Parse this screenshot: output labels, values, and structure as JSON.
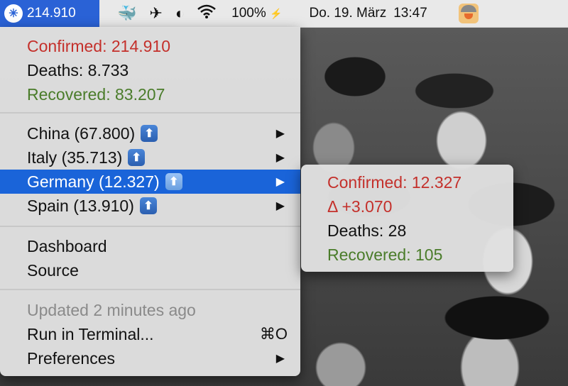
{
  "menubar": {
    "app_count": "214.910",
    "app_icon": "covid-tracker-icon",
    "icons": [
      "docker-icon",
      "paper-plane-icon",
      "half-circle-icon",
      "wifi-icon"
    ],
    "battery": "100%",
    "battery_symbol": "⚡",
    "date": "Do. 19. März",
    "time": "13:47",
    "avatar": "viking-avatar"
  },
  "menu": {
    "summary": {
      "confirmed": "Confirmed: 214.910",
      "deaths": "Deaths: 8.733",
      "recovered": "Recovered: 83.207"
    },
    "countries": [
      {
        "label": "China (67.800)",
        "arrow": "▶"
      },
      {
        "label": "Italy (35.713)",
        "arrow": "▶"
      },
      {
        "label": "Germany (12.327)",
        "arrow": "▶"
      },
      {
        "label": "Spain (13.910)",
        "arrow": "▶"
      }
    ],
    "links": {
      "dashboard": "Dashboard",
      "source": "Source"
    },
    "footer": {
      "updated": "Updated 2 minutes ago",
      "run_terminal": "Run in Terminal...",
      "run_shortcut": "⌘O",
      "preferences": "Preferences",
      "preferences_arrow": "▶"
    },
    "up_glyph": "⬆"
  },
  "submenu": {
    "confirmed": "Confirmed: 12.327",
    "delta": "Δ +3.070",
    "deaths": "Deaths: 28",
    "recovered": "Recovered: 105"
  }
}
